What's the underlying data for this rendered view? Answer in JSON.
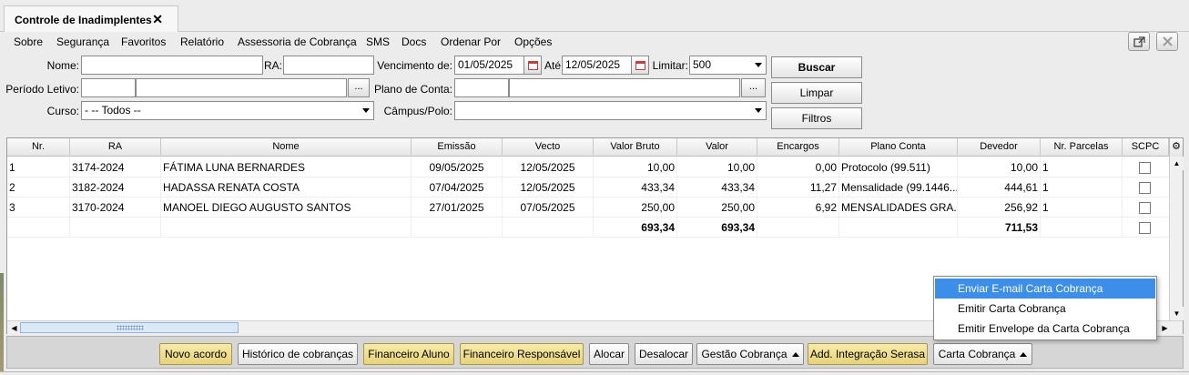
{
  "tab": {
    "title": "Controle de Inadimplentes",
    "close": "✕"
  },
  "menu": [
    "Sobre",
    "Segurança",
    "Favoritos",
    "Relatório",
    "Assessoria de Cobrança",
    "SMS",
    "Docs",
    "Ordenar Por",
    "Opções"
  ],
  "window_buttons": {
    "popout_icon": "popout-icon",
    "close_icon": "close-icon"
  },
  "filters": {
    "nome_label": "Nome:",
    "nome_value": "",
    "ra_label": "RA:",
    "ra_value": "",
    "vencimento_label": "Vencimento de:",
    "vencimento_de": "01/05/2025",
    "ate_label": "Até",
    "vencimento_ate": "12/05/2025",
    "limitar_label": "Limitar:",
    "limitar_value": "500",
    "periodo_label": "Período Letivo:",
    "periodo_code": "",
    "periodo_desc": "",
    "plano_label": "Plano de Conta:",
    "plano_code": "",
    "plano_desc": "",
    "curso_label": "Curso:",
    "curso_value": "- -- Todos --",
    "campus_label": "Câmpus/Polo:",
    "campus_value": "",
    "ellipsis": "..."
  },
  "actions": {
    "buscar": "Buscar",
    "limpar": "Limpar",
    "filtros": "Filtros"
  },
  "table": {
    "columns": [
      "Nr.",
      "RA",
      "Nome",
      "Emissão",
      "Vecto",
      "Valor Bruto",
      "Valor",
      "Encargos",
      "Plano Conta",
      "Devedor",
      "Nr. Parcelas",
      "SCPC"
    ],
    "rows": [
      {
        "nr": "1",
        "ra": "3174-2024",
        "nome": "FÁTIMA LUNA BERNARDES",
        "emissao": "09/05/2025",
        "vecto": "12/05/2025",
        "bruto": "10,00",
        "valor": "10,00",
        "encargos": "0,00",
        "plano": "Protocolo (99.511)",
        "devedor": "10,00",
        "parcelas": "1"
      },
      {
        "nr": "2",
        "ra": "3182-2024",
        "nome": "HADASSA RENATA COSTA",
        "emissao": "07/04/2025",
        "vecto": "12/05/2025",
        "bruto": "433,34",
        "valor": "433,34",
        "encargos": "11,27",
        "plano": "Mensalidade (99.1446...",
        "devedor": "444,61",
        "parcelas": "1"
      },
      {
        "nr": "3",
        "ra": "3170-2024",
        "nome": "MANOEL DIEGO AUGUSTO SANTOS",
        "emissao": "27/01/2025",
        "vecto": "07/05/2025",
        "bruto": "250,00",
        "valor": "250,00",
        "encargos": "6,92",
        "plano": "MENSALIDADES GRA...",
        "devedor": "256,92",
        "parcelas": "1"
      }
    ],
    "totals": {
      "bruto": "693,34",
      "valor": "693,34",
      "devedor": "711,53"
    }
  },
  "bottom_buttons": {
    "novo_acordo": "Novo acordo",
    "historico": "Histórico de cobranças",
    "fin_aluno": "Financeiro Aluno",
    "fin_resp": "Financeiro Responsável",
    "alocar": "Alocar",
    "desalocar": "Desalocar",
    "gestao": "Gestão Cobrança",
    "serasa": "Add. Integração Serasa",
    "carta": "Carta Cobrança"
  },
  "carta_menu": [
    "Enviar E-mail Carta Cobrança",
    "Emitir Carta Cobrança",
    "Emitir Envelope da Carta Cobrança"
  ],
  "colors": {
    "menu_selected": "#3d8ee8",
    "yellow_button": "#e7d27a"
  }
}
